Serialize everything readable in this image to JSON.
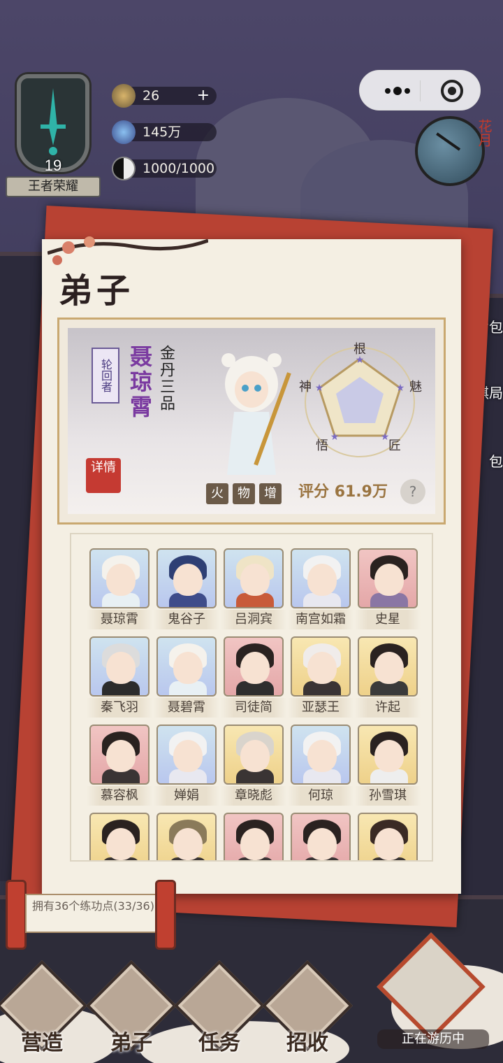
{
  "player": {
    "level": "19",
    "title": "王者荣耀"
  },
  "resources": [
    {
      "icon": "spirit-coin-icon",
      "value": "26",
      "has_plus": true
    },
    {
      "icon": "crystal-icon",
      "value": "145万"
    },
    {
      "icon": "yinyang-icon",
      "value": "1000/1000"
    }
  ],
  "clock": {
    "label": "花月"
  },
  "side_menu": [
    "背包",
    "回棋局",
    "包"
  ],
  "panel": {
    "title": "弟子",
    "featured": {
      "role_tag": "轮回者",
      "name": "聂琼霄",
      "rank": "金丹三品",
      "detail_label": "详情",
      "elements": [
        "火",
        "物",
        "增"
      ],
      "radar_labels": [
        "根",
        "魅",
        "匠",
        "悟",
        "神"
      ],
      "score_label": "评分",
      "score_value": "61.9万",
      "help_label": "?"
    },
    "disciples": [
      {
        "name": "聂琼霄",
        "bg": "blue",
        "hair": "#f5f2ec",
        "robe": "#e8f0f4"
      },
      {
        "name": "鬼谷子",
        "bg": "blue",
        "hair": "#2e3f74",
        "robe": "#3e4c8a"
      },
      {
        "name": "吕洞宾",
        "bg": "blue",
        "hair": "#efe4c6",
        "robe": "#c85a3a"
      },
      {
        "name": "南宫如霜",
        "bg": "blue",
        "hair": "#f2f2f2",
        "robe": "#e8e8f0"
      },
      {
        "name": "史星",
        "bg": "pink",
        "hair": "#2a2220",
        "robe": "#8a76a4"
      },
      {
        "name": "秦飞羽",
        "bg": "blue",
        "hair": "#dcdcdc",
        "robe": "#2c2c2c"
      },
      {
        "name": "聂碧霄",
        "bg": "blue",
        "hair": "#f5f2ec",
        "robe": "#e8f0f4"
      },
      {
        "name": "司徒简",
        "bg": "pink",
        "hair": "#2a2220",
        "robe": "#2e2e2e"
      },
      {
        "name": "亚瑟王",
        "bg": "yellow",
        "hair": "#f0ecea",
        "robe": "#3a3434"
      },
      {
        "name": "许起",
        "bg": "yellow",
        "hair": "#2a2220",
        "robe": "#3a3a3a"
      },
      {
        "name": "慕容枫",
        "bg": "pink",
        "hair": "#2a2220",
        "robe": "#3a3434"
      },
      {
        "name": "婵娟",
        "bg": "blue",
        "hair": "#f2f2f2",
        "robe": "#e8e8f0"
      },
      {
        "name": "章晓彪",
        "bg": "yellow",
        "hair": "#d9d4cc",
        "robe": "#3a3434"
      },
      {
        "name": "何琼",
        "bg": "blue",
        "hair": "#f2f2f2",
        "robe": "#e8e8f0"
      },
      {
        "name": "孙雪琪",
        "bg": "yellow",
        "hair": "#2a2220",
        "robe": "#eeeeee"
      },
      {
        "name": "",
        "bg": "yellow",
        "hair": "#2a2220",
        "robe": "#3a3434"
      },
      {
        "name": "",
        "bg": "yellow",
        "hair": "#8a7a5a",
        "robe": "#3a3434"
      },
      {
        "name": "",
        "bg": "pink",
        "hair": "#2a2220",
        "robe": "#3a3434"
      },
      {
        "name": "",
        "bg": "pink",
        "hair": "#2a2220",
        "robe": "#3a3434"
      },
      {
        "name": "",
        "bg": "yellow",
        "hair": "#3a2a24",
        "robe": "#3a3434"
      }
    ]
  },
  "quest": {
    "text": "拥有36个练功点(33/36)"
  },
  "nav": [
    {
      "label": "营造",
      "icon": "build-icon"
    },
    {
      "label": "弟子",
      "icon": "disciple-icon"
    },
    {
      "label": "任务",
      "icon": "task-icon"
    },
    {
      "label": "招收",
      "icon": "recruit-icon"
    }
  ],
  "travel": {
    "label": "正在游历中"
  }
}
